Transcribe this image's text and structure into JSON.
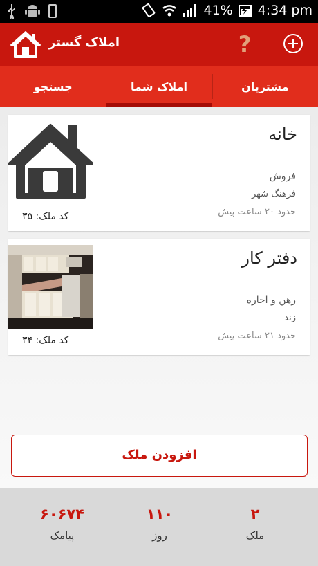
{
  "status_bar": {
    "battery": "41%",
    "time": "4:34 pm"
  },
  "app_bar": {
    "title": "املاک گستر",
    "help_icon": "question-mark-icon",
    "add_icon": "plus-circle-icon",
    "logo_icon": "house-icon"
  },
  "tabs": [
    {
      "label": "مشتریان",
      "active": false
    },
    {
      "label": "املاک شما",
      "active": true
    },
    {
      "label": "جستجو",
      "active": false
    }
  ],
  "listings": [
    {
      "title": "خانه",
      "type": "فروش",
      "area": "فرهنگ شهر",
      "time": "حدود ۲۰ ساعت پیش",
      "code": "کد ملک: ۳۵",
      "thumbnail": "house-icon"
    },
    {
      "title": "دفتر کار",
      "type": "رهن و اجاره",
      "area": "زند",
      "time": "حدود ۲۱ ساعت پیش",
      "code": "کد ملک: ۳۴",
      "thumbnail": "kitchen-photo"
    }
  ],
  "add_button": {
    "label": "افزودن ملک"
  },
  "stats": [
    {
      "value": "۶۰۶۷۴",
      "label": "پیامک"
    },
    {
      "value": "۱۱۰",
      "label": "روز"
    },
    {
      "value": "۲",
      "label": "ملک"
    }
  ],
  "colors": {
    "primary": "#c8170e",
    "tab_bar": "#e12d1c",
    "active_tab_indicator": "#a40c06"
  }
}
